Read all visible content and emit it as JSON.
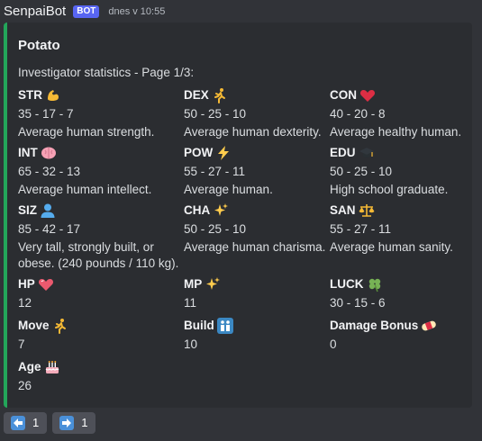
{
  "message": {
    "author": "SenpaiBot",
    "badge": "BOT",
    "timestamp": "dnes v 10:55"
  },
  "embed": {
    "accent_color": "#23a55a",
    "title": "Potato",
    "description": "Investigator statistics - Page 1/3:",
    "fields": {
      "str": {
        "name": "STR",
        "icon": "flexed-biceps-icon",
        "value": "35 - 17 - 7",
        "desc": "Average human strength."
      },
      "dex": {
        "name": "DEX",
        "icon": "running-person-icon",
        "value": "50 - 25 - 10",
        "desc": "Average human dexterity."
      },
      "con": {
        "name": "CON",
        "icon": "red-heart-icon",
        "value": "40 - 20 - 8",
        "desc": "Average healthy human."
      },
      "int": {
        "name": "INT",
        "icon": "brain-icon",
        "value": "65 - 32 - 13",
        "desc": "Average human intellect."
      },
      "pow": {
        "name": "POW",
        "icon": "lightning-icon",
        "value": "55 - 27 - 11",
        "desc": "Average human."
      },
      "edu": {
        "name": "EDU",
        "icon": "graduation-cap-icon",
        "value": "50 - 25 - 10",
        "desc": "High school graduate."
      },
      "siz": {
        "name": "SIZ",
        "icon": "person-silhouette-icon",
        "value": "85 - 42 - 17",
        "desc": "Very tall, strongly built, or obese. (240 pounds / 110 kg)."
      },
      "cha": {
        "name": "CHA",
        "icon": "sparkles-icon",
        "value": "50 - 25 - 10",
        "desc": "Average human charisma."
      },
      "san": {
        "name": "SAN",
        "icon": "balance-scale-icon",
        "value": "55 - 27 - 11",
        "desc": "Average human sanity."
      },
      "hp": {
        "name": "HP",
        "icon": "pink-heart-icon",
        "value": "12"
      },
      "mp": {
        "name": "MP",
        "icon": "sparkles-icon",
        "value": "11"
      },
      "luck": {
        "name": "LUCK",
        "icon": "four-leaf-clover-icon",
        "value": "30 - 15 - 6"
      },
      "move": {
        "name": "Move",
        "icon": "running-person-icon",
        "value": "7"
      },
      "build": {
        "name": "Build",
        "icon": "family-icon",
        "value": "10"
      },
      "damage_bonus": {
        "name": "Damage Bonus",
        "icon": "bandage-icon",
        "value": "0"
      },
      "age": {
        "name": "Age",
        "icon": "birthday-cake-icon",
        "value": "26"
      }
    }
  },
  "buttons": [
    {
      "icon": "arrow-left-icon",
      "label": "1"
    },
    {
      "icon": "arrow-right-icon",
      "label": "1"
    }
  ]
}
